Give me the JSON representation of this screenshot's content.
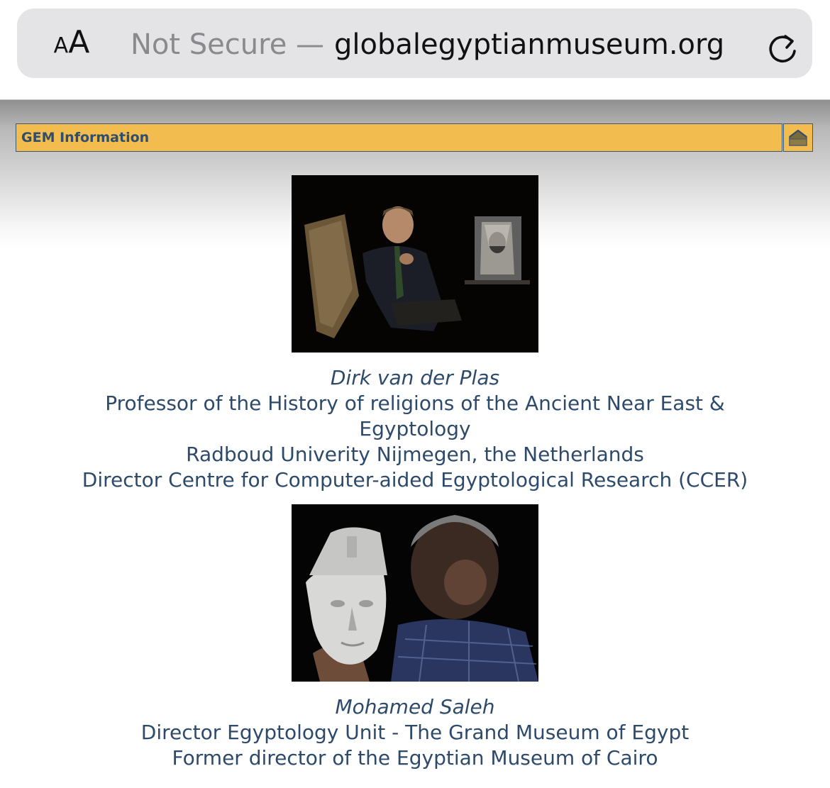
{
  "browser": {
    "text_size_label_small": "A",
    "text_size_label_large": "A",
    "security_label": "Not Secure —",
    "domain": "globalegyptianmuseum.org"
  },
  "header": {
    "title": "GEM Information"
  },
  "people": [
    {
      "name": "Dirk van der Plas",
      "lines": [
        "Professor of the History of religions of the Ancient Near East &",
        "Egyptology",
        "Radboud Univerity Nijmegen, the Netherlands",
        "Director Centre for Computer-aided Egyptological Research (CCER)"
      ]
    },
    {
      "name": "Mohamed Saleh",
      "lines": [
        "Director Egyptology Unit - The Grand Museum of Egypt",
        "Former director of the Egyptian Museum of Cairo"
      ]
    }
  ],
  "icons": {
    "reload": "reload-icon",
    "home": "home-icon"
  }
}
